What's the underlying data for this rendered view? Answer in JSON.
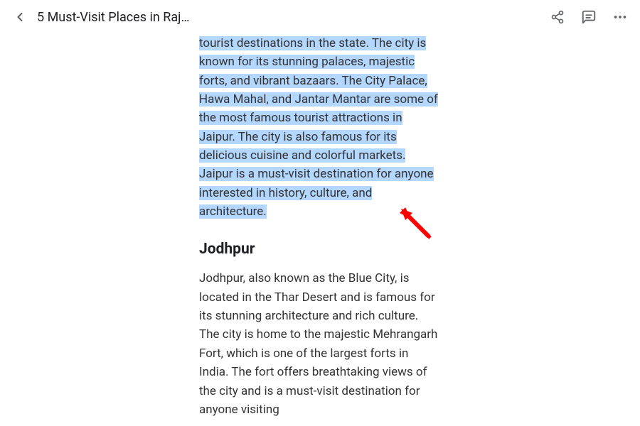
{
  "header": {
    "title": "5 Must-Visit Places in Raj…"
  },
  "content": {
    "paragraph1_highlighted": "tourist destinations in the state. The city is known for its stunning palaces, majestic forts, and vibrant bazaars. The City Palace, Hawa Mahal, and Jantar Mantar are some of the most famous tourist attractions in Jaipur. The city is also famous for its delicious cuisine and colorful markets. Jaipur is a must-visit destination for anyone interested in history, culture, and architecture.",
    "heading2": "Jodhpur",
    "paragraph2": "Jodhpur, also known as the Blue City, is located in the Thar Desert and is famous for its stunning architecture and rich culture. The city is home to the majestic Mehrangarh Fort, which is one of the largest forts in India. The fort offers breathtaking views of the city and is a must-visit destination for anyone visiting"
  },
  "icons": {
    "back": "back-icon",
    "share": "share-icon",
    "comment": "comment-icon",
    "more": "more-icon"
  }
}
